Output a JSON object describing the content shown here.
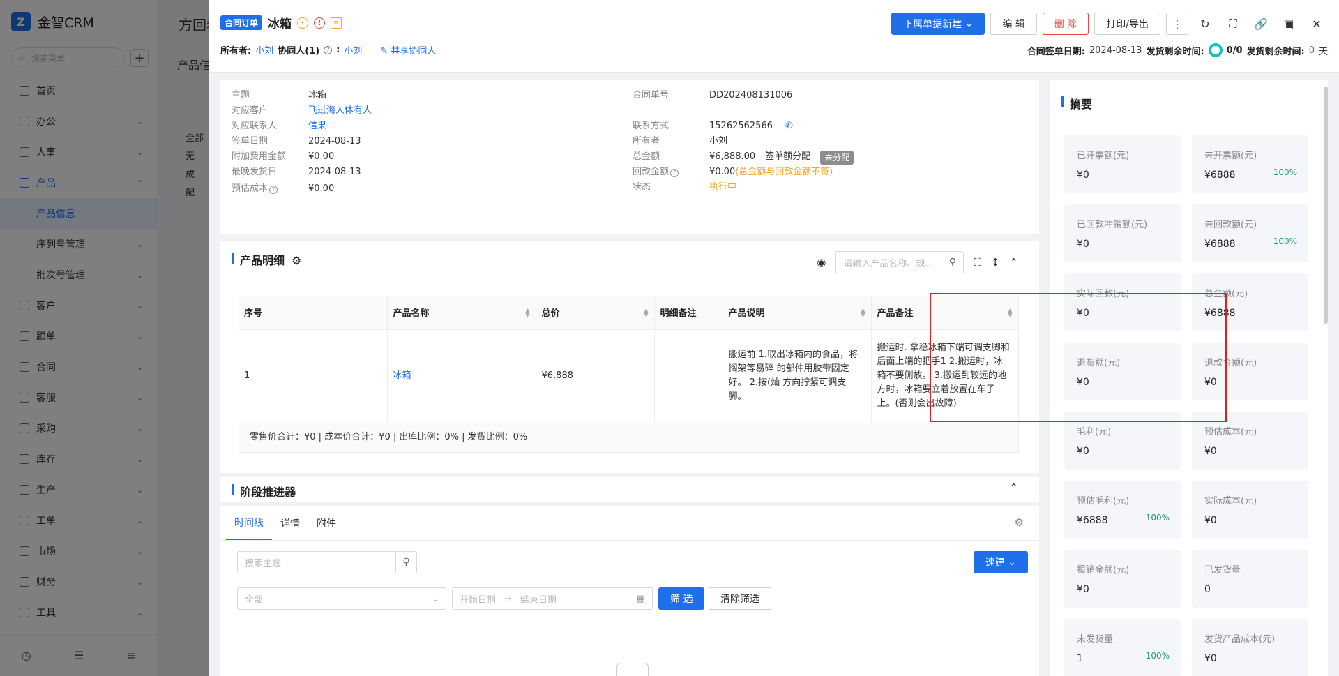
{
  "app": {
    "logo_text": "金智CRM",
    "search_placeholder": "搜索菜单",
    "nav": [
      {
        "label": "首页"
      },
      {
        "label": "办公"
      },
      {
        "label": "人事"
      },
      {
        "label": "产品"
      },
      {
        "label": "产品信息"
      },
      {
        "label": "序列号管理"
      },
      {
        "label": "批次号管理"
      },
      {
        "label": "客户"
      },
      {
        "label": "跟单"
      },
      {
        "label": "合同"
      },
      {
        "label": "客服"
      },
      {
        "label": "采购"
      },
      {
        "label": "库存"
      },
      {
        "label": "生产"
      },
      {
        "label": "工单"
      },
      {
        "label": "市场"
      },
      {
        "label": "财务"
      },
      {
        "label": "工具"
      }
    ],
    "bg_tab": "方回看",
    "bg_panel_title": "产品信",
    "bg_tree": [
      "全部",
      "无",
      "成",
      "配"
    ]
  },
  "header": {
    "tag": "合同订单",
    "title": "冰箱",
    "owner_label": "所有者:",
    "owner": "小刘",
    "collab_label": "协同人(1)",
    "collab_sep": ":",
    "collab": "小刘",
    "share": "共享协同人",
    "actions": {
      "new_sub": "下属单据新建",
      "edit": "编 辑",
      "delete": "删 除",
      "print": "打印/导出"
    },
    "sign_date_label": "合同签单日期:",
    "sign_date": "2024-08-13",
    "ship_remain_label1": "发货剩余时间:",
    "ship_progress": "0/0",
    "ship_remain_label2": "发货剩余时间:",
    "ship_remain_value": "0",
    "ship_remain_unit": "天"
  },
  "info": {
    "subject_k": "主题",
    "subject_v": "冰箱",
    "customer_k": "对应客户",
    "customer_v": "飞过海人体有人",
    "contact_k": "对应联系人",
    "contact_v": "信果",
    "sign_k": "签单日期",
    "sign_v": "2024-08-13",
    "extra_k": "附加费用金额",
    "extra_v": "¥0.00",
    "latest_k": "最晚发货日",
    "latest_v": "2024-08-13",
    "estcost_k": "预估成本",
    "estcost_v": "¥0.00",
    "no_k": "合同单号",
    "no_v": "DD202408131006",
    "phone_k": "联系方式",
    "phone_v": "15262562566",
    "owner_k": "所有者",
    "owner_v": "小刘",
    "total_k": "总金额",
    "total_v": "¥6,888.00",
    "alloc": "签单额分配",
    "alloc_badge": "未分配",
    "paid_k": "回款金额",
    "paid_v": "¥0.00",
    "paid_warn": "(总金额与回款金额不符)",
    "status_k": "状态",
    "status_v": "执行中"
  },
  "products": {
    "title": "产品明细",
    "search_placeholder": "请输入产品名称、规...",
    "columns": [
      "序号",
      "产品名称",
      "总价",
      "明细备注",
      "产品说明",
      "产品备注"
    ],
    "rows": [
      {
        "no": "1",
        "name": "冰箱",
        "total": "¥6,888",
        "detail_note": "",
        "desc": "搬运前 1.取出冰箱内的食品，将搁架等易碎 的部件用胶带固定好。 2.按(灿 方向拧紧可调支脚。",
        "note": "搬运时. 拿稳冰箱下端可调支脚和后面上端的把手1 2.搬运时，冰箱不要侧放。 3.搬运到较远的地方时，冰箱要立着放置在车子上。(否则会出故障)"
      }
    ],
    "footer": "零售价合计：¥0 |   成本价合计：¥0 |   出库比例：0% |   发货比例：0%"
  },
  "stage": {
    "title": "阶段推进器"
  },
  "timeline": {
    "tabs": [
      "时间线",
      "详情",
      "附件"
    ],
    "search_placeholder": "搜索主题",
    "quick": "速建",
    "select_all": "全部",
    "start_date": "开始日期",
    "end_date": "结束日期",
    "filter": "筛 选",
    "clear": "清除筛选"
  },
  "summary": {
    "title": "摘要",
    "items": [
      {
        "label": "已开票额(元)",
        "value": "¥0",
        "pct": ""
      },
      {
        "label": "未开票额(元)",
        "value": "¥6888",
        "pct": "100%"
      },
      {
        "label": "已回款冲销额(元)",
        "value": "¥0",
        "pct": ""
      },
      {
        "label": "未回款额(元)",
        "value": "¥6888",
        "pct": "100%"
      },
      {
        "label": "实际回款(元)",
        "value": "¥0",
        "pct": ""
      },
      {
        "label": "总金额(元)",
        "value": "¥6888",
        "pct": ""
      },
      {
        "label": "退货额(元)",
        "value": "¥0",
        "pct": ""
      },
      {
        "label": "退款金额(元)",
        "value": "¥0",
        "pct": ""
      },
      {
        "label": "毛利(元)",
        "value": "¥0",
        "pct": ""
      },
      {
        "label": "预估成本(元)",
        "value": "¥0",
        "pct": ""
      },
      {
        "label": "预估毛利(元)",
        "value": "¥6888",
        "pct": "100%"
      },
      {
        "label": "实际成本(元)",
        "value": "¥0",
        "pct": ""
      },
      {
        "label": "报销金额(元)",
        "value": "¥0",
        "pct": ""
      },
      {
        "label": "已发货量",
        "value": "0",
        "pct": ""
      },
      {
        "label": "未发货量",
        "value": "1",
        "pct": "100%"
      },
      {
        "label": "发货产品成本(元)",
        "value": "¥0",
        "pct": ""
      }
    ]
  },
  "colors": {
    "primary": "#1f6feb",
    "danger": "#e54545",
    "success": "#19a15f",
    "warning": "#f5a623"
  }
}
